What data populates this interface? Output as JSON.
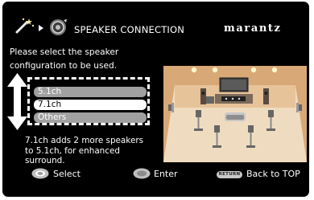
{
  "header": {
    "title": "SPEAKER CONNECTION",
    "brand": "marantz",
    "icons": [
      "magic-wand-icon",
      "play-arrow-icon",
      "speaker-setup-icon"
    ]
  },
  "instructions": {
    "line1": "Please select the speaker",
    "line2": "configuration to be used."
  },
  "options": [
    {
      "label": "5.1ch",
      "selected": false
    },
    {
      "label": "7.1ch",
      "selected": true
    },
    {
      "label": "Others",
      "selected": false
    }
  ],
  "description": {
    "line1": "7.1ch adds 2 more speakers",
    "line2": "to 5.1ch, for enhanced",
    "line3": "surround."
  },
  "guide": {
    "select_label": "Select",
    "enter_label": "Enter",
    "return_button": "RETURN",
    "back_label": "Back to TOP"
  },
  "illustration": {
    "name": "7.1ch speaker layout room",
    "colors": {
      "room_floor": "#efdcc0",
      "room_wall": "#d8a877",
      "sofa": "#c7c7c7"
    }
  }
}
